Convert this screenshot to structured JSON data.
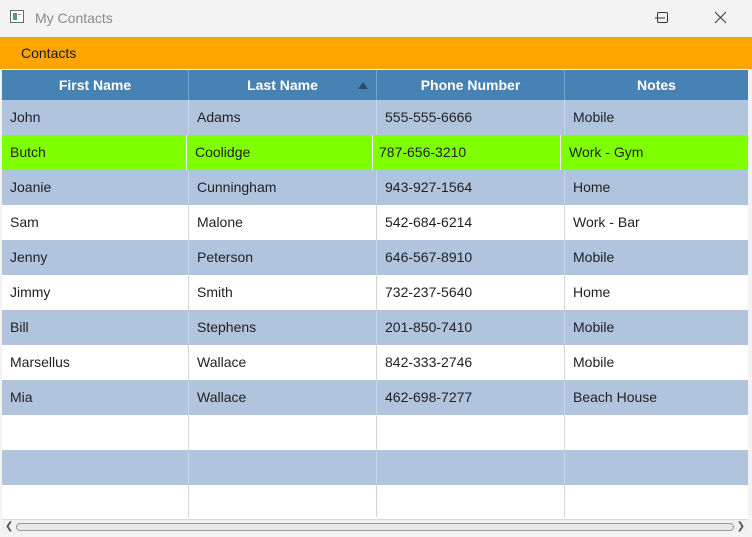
{
  "window": {
    "title": "My Contacts",
    "icons": {
      "app": "window-app-icon",
      "minimize": "minimize-icon",
      "maximize": "maximize-icon",
      "close": "close-icon"
    }
  },
  "tabs": [
    {
      "label": "Contacts",
      "active": true
    }
  ],
  "table": {
    "columns": [
      {
        "label": "First Name"
      },
      {
        "label": "Last Name",
        "sort": "ascending"
      },
      {
        "label": "Phone Number"
      },
      {
        "label": "Notes"
      }
    ],
    "rows": [
      {
        "first": "John",
        "last": "Adams",
        "phone": "555-555-6666",
        "notes": "Mobile"
      },
      {
        "first": "Butch",
        "last": "Coolidge",
        "phone": "787-656-3210",
        "notes": "Work - Gym"
      },
      {
        "first": "Joanie",
        "last": "Cunningham",
        "phone": "943-927-1564",
        "notes": "Home"
      },
      {
        "first": "Sam",
        "last": "Malone",
        "phone": "542-684-6214",
        "notes": "Work - Bar"
      },
      {
        "first": "Jenny",
        "last": "Peterson",
        "phone": "646-567-8910",
        "notes": "Mobile"
      },
      {
        "first": "Jimmy",
        "last": "Smith",
        "phone": "732-237-5640",
        "notes": "Home"
      },
      {
        "first": "Bill",
        "last": "Stephens",
        "phone": "201-850-7410",
        "notes": "Mobile"
      },
      {
        "first": "Marsellus",
        "last": "Wallace",
        "phone": "842-333-2746",
        "notes": "Mobile"
      },
      {
        "first": "Mia",
        "last": "Wallace",
        "phone": "462-698-7277",
        "notes": "Beach House"
      }
    ],
    "selected_row": 1
  },
  "colors": {
    "tab_bar": "#ffa500",
    "header": "#4682b4",
    "alt_row": "#b0c4de",
    "selected_row": "#7fff00"
  }
}
